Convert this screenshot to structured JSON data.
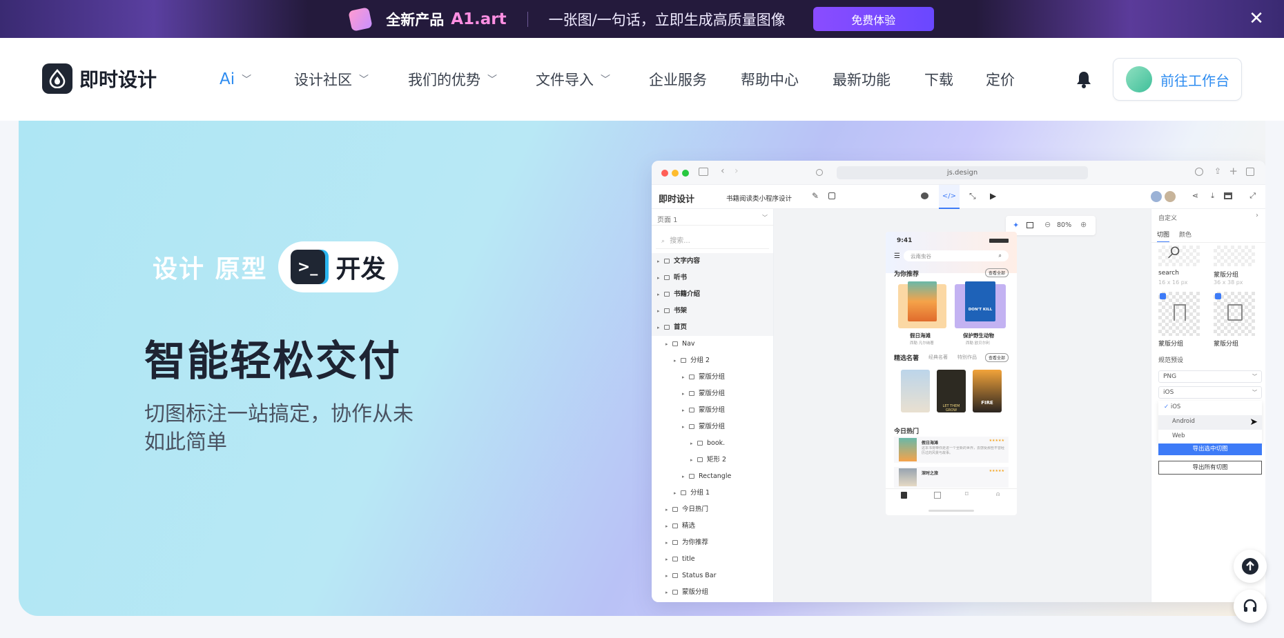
{
  "banner": {
    "new_label": "全新产品",
    "product": "A1.art",
    "tagline": "一张图/一句话，立即生成高质量图像",
    "cta": "免费体验",
    "close": "✕"
  },
  "nav": {
    "logo_text": "即时设计",
    "items": [
      {
        "label": "Ai",
        "has_dropdown": true
      },
      {
        "label": "设计社区",
        "has_dropdown": true
      },
      {
        "label": "我们的优势",
        "has_dropdown": true
      },
      {
        "label": "文件导入",
        "has_dropdown": true
      },
      {
        "label": "企业服务",
        "has_dropdown": false
      },
      {
        "label": "帮助中心",
        "has_dropdown": false
      },
      {
        "label": "最新功能",
        "has_dropdown": false
      },
      {
        "label": "下载",
        "has_dropdown": false
      },
      {
        "label": "定价",
        "has_dropdown": false
      }
    ],
    "workbench": "前往工作台"
  },
  "hero": {
    "tags": "设计 原型",
    "pill_label": "开发",
    "title": "智能轻松交付",
    "subtitle": "切图标注一站搞定，协作从未如此简单"
  },
  "mockup": {
    "url": "js.design",
    "brand": "即时设计",
    "file_name": "书籍阅读类小程序设计",
    "zoom": "80%",
    "page_select": "页面 1",
    "search_placeholder": "搜索...",
    "layers": [
      {
        "label": "文字内容",
        "indent": 0,
        "bold": true
      },
      {
        "label": "听书",
        "indent": 0,
        "bold": true
      },
      {
        "label": "书籍介绍",
        "indent": 0,
        "bold": true
      },
      {
        "label": "书架",
        "indent": 0,
        "bold": true
      },
      {
        "label": "首页",
        "indent": 0,
        "bold": true
      },
      {
        "label": "Nav",
        "indent": 1,
        "bold": false
      },
      {
        "label": "分组 2",
        "indent": 2,
        "bold": false
      },
      {
        "label": "蒙版分组",
        "indent": 3,
        "bold": false
      },
      {
        "label": "蒙版分组",
        "indent": 3,
        "bold": false
      },
      {
        "label": "蒙版分组",
        "indent": 3,
        "bold": false
      },
      {
        "label": "蒙版分组",
        "indent": 3,
        "bold": false
      },
      {
        "label": "book.",
        "indent": 4,
        "bold": false
      },
      {
        "label": "矩形 2",
        "indent": 4,
        "bold": false
      },
      {
        "label": "Rectangle",
        "indent": 3,
        "bold": false
      },
      {
        "label": "分组 1",
        "indent": 2,
        "bold": false
      },
      {
        "label": "今日热门",
        "indent": 1,
        "bold": false
      },
      {
        "label": "精选",
        "indent": 1,
        "bold": false
      },
      {
        "label": "为你推荐",
        "indent": 1,
        "bold": false
      },
      {
        "label": "title",
        "indent": 1,
        "bold": false
      },
      {
        "label": "Status Bar",
        "indent": 1,
        "bold": false
      },
      {
        "label": "蒙版分组",
        "indent": 1,
        "bold": false
      }
    ],
    "phone": {
      "time": "9:41",
      "search": "云南虫谷",
      "section_recommend": "为你推荐",
      "see_all": "查看全部",
      "book1_title": "假日海滩",
      "book1_meta": "西勒 凡尔纳著",
      "book2_title": "保护野生动物",
      "book2_meta": "西勒 欧贝尔利",
      "book2_cover_text": "DON'T KILL",
      "section_featured": "精选名著",
      "tab_classic": "经典名著",
      "tab_special": "特别作品",
      "cover_let": "LET THEM GROW",
      "cover_fire": "FIRE",
      "section_hot": "今日热门",
      "hot1_title": "假日海滩",
      "hot1_desc": "这本书将带你走进一个全新的世界，去感受那些不曾经历过的风景与故事。",
      "hot2_title": "深时之旅",
      "stars": "★★★★★"
    },
    "right": {
      "title": "自定义",
      "tab_slice": "切图",
      "tab_color": "颜色",
      "asset1_name": "search",
      "asset1_size": "16 x 16 px",
      "asset2_name": "蒙版分组",
      "asset2_size": "36 x 38 px",
      "asset3_name": "蒙版分组",
      "asset4_name": "蒙版分组",
      "preset": "规范预设",
      "format": "PNG",
      "platform": "iOS",
      "options": [
        "iOS",
        "Android",
        "Web"
      ],
      "export_selected": "导出选中切图",
      "export_all": "导出所有切图"
    }
  },
  "colors": {
    "accent": "#2e8cf0",
    "banner_bg": "#241a3c",
    "dark": "#1f2633",
    "export_blue": "#3d7bf7"
  }
}
